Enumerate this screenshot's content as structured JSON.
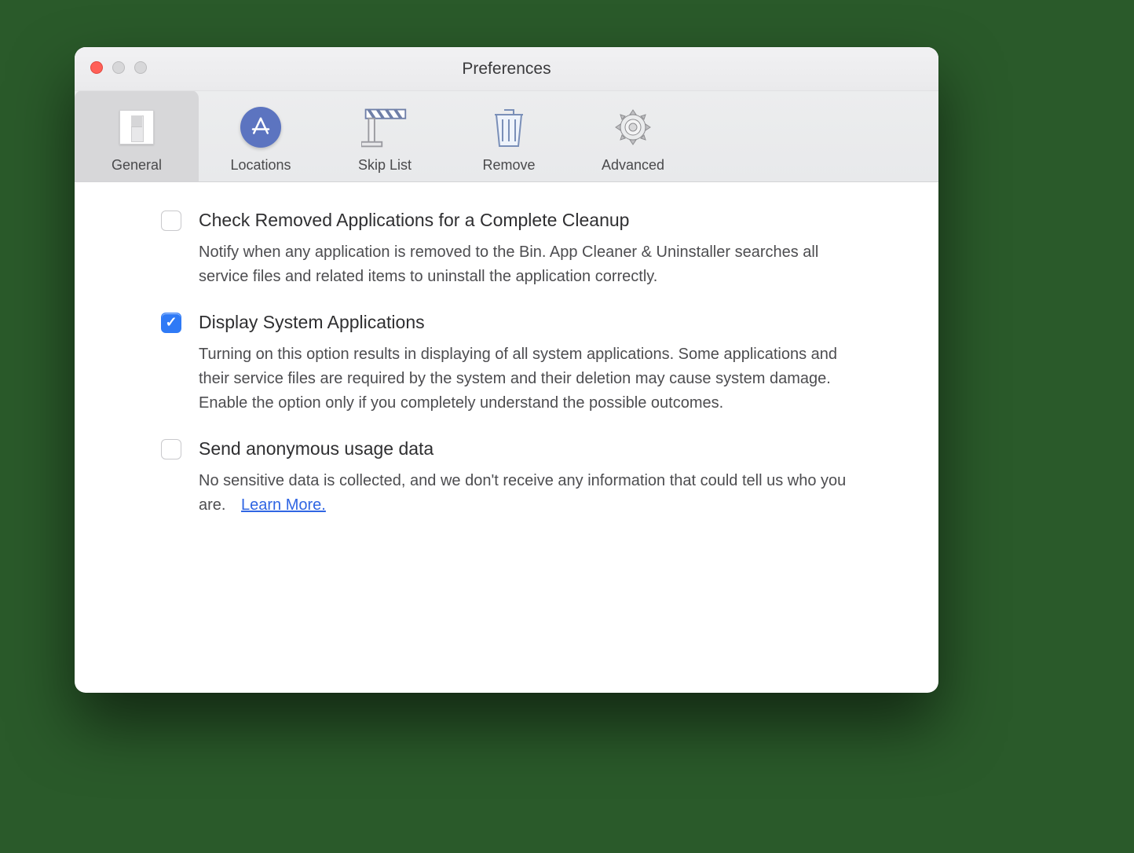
{
  "window": {
    "title": "Preferences"
  },
  "tabs": [
    {
      "label": "General",
      "icon": "switch-icon",
      "active": true
    },
    {
      "label": "Locations",
      "icon": "appstore-icon",
      "active": false
    },
    {
      "label": "Skip List",
      "icon": "barrier-icon",
      "active": false
    },
    {
      "label": "Remove",
      "icon": "trash-icon",
      "active": false
    },
    {
      "label": "Advanced",
      "icon": "gear-icon",
      "active": false
    }
  ],
  "options": [
    {
      "checked": false,
      "title": "Check Removed Applications for a Complete Cleanup",
      "desc": "Notify when any application is removed to the Bin. App Cleaner & Uninstaller searches all service files and related items to uninstall the application correctly."
    },
    {
      "checked": true,
      "title": "Display System Applications",
      "desc": "Turning on this option results in displaying of all system applications. Some applications and their service files are required by the system and their deletion may cause system damage. Enable the option only if you completely understand the possible outcomes."
    },
    {
      "checked": false,
      "title": "Send anonymous usage data",
      "desc": "No sensitive data is collected, and we don't receive any information that could tell us who you are.",
      "link": "Learn More."
    }
  ]
}
